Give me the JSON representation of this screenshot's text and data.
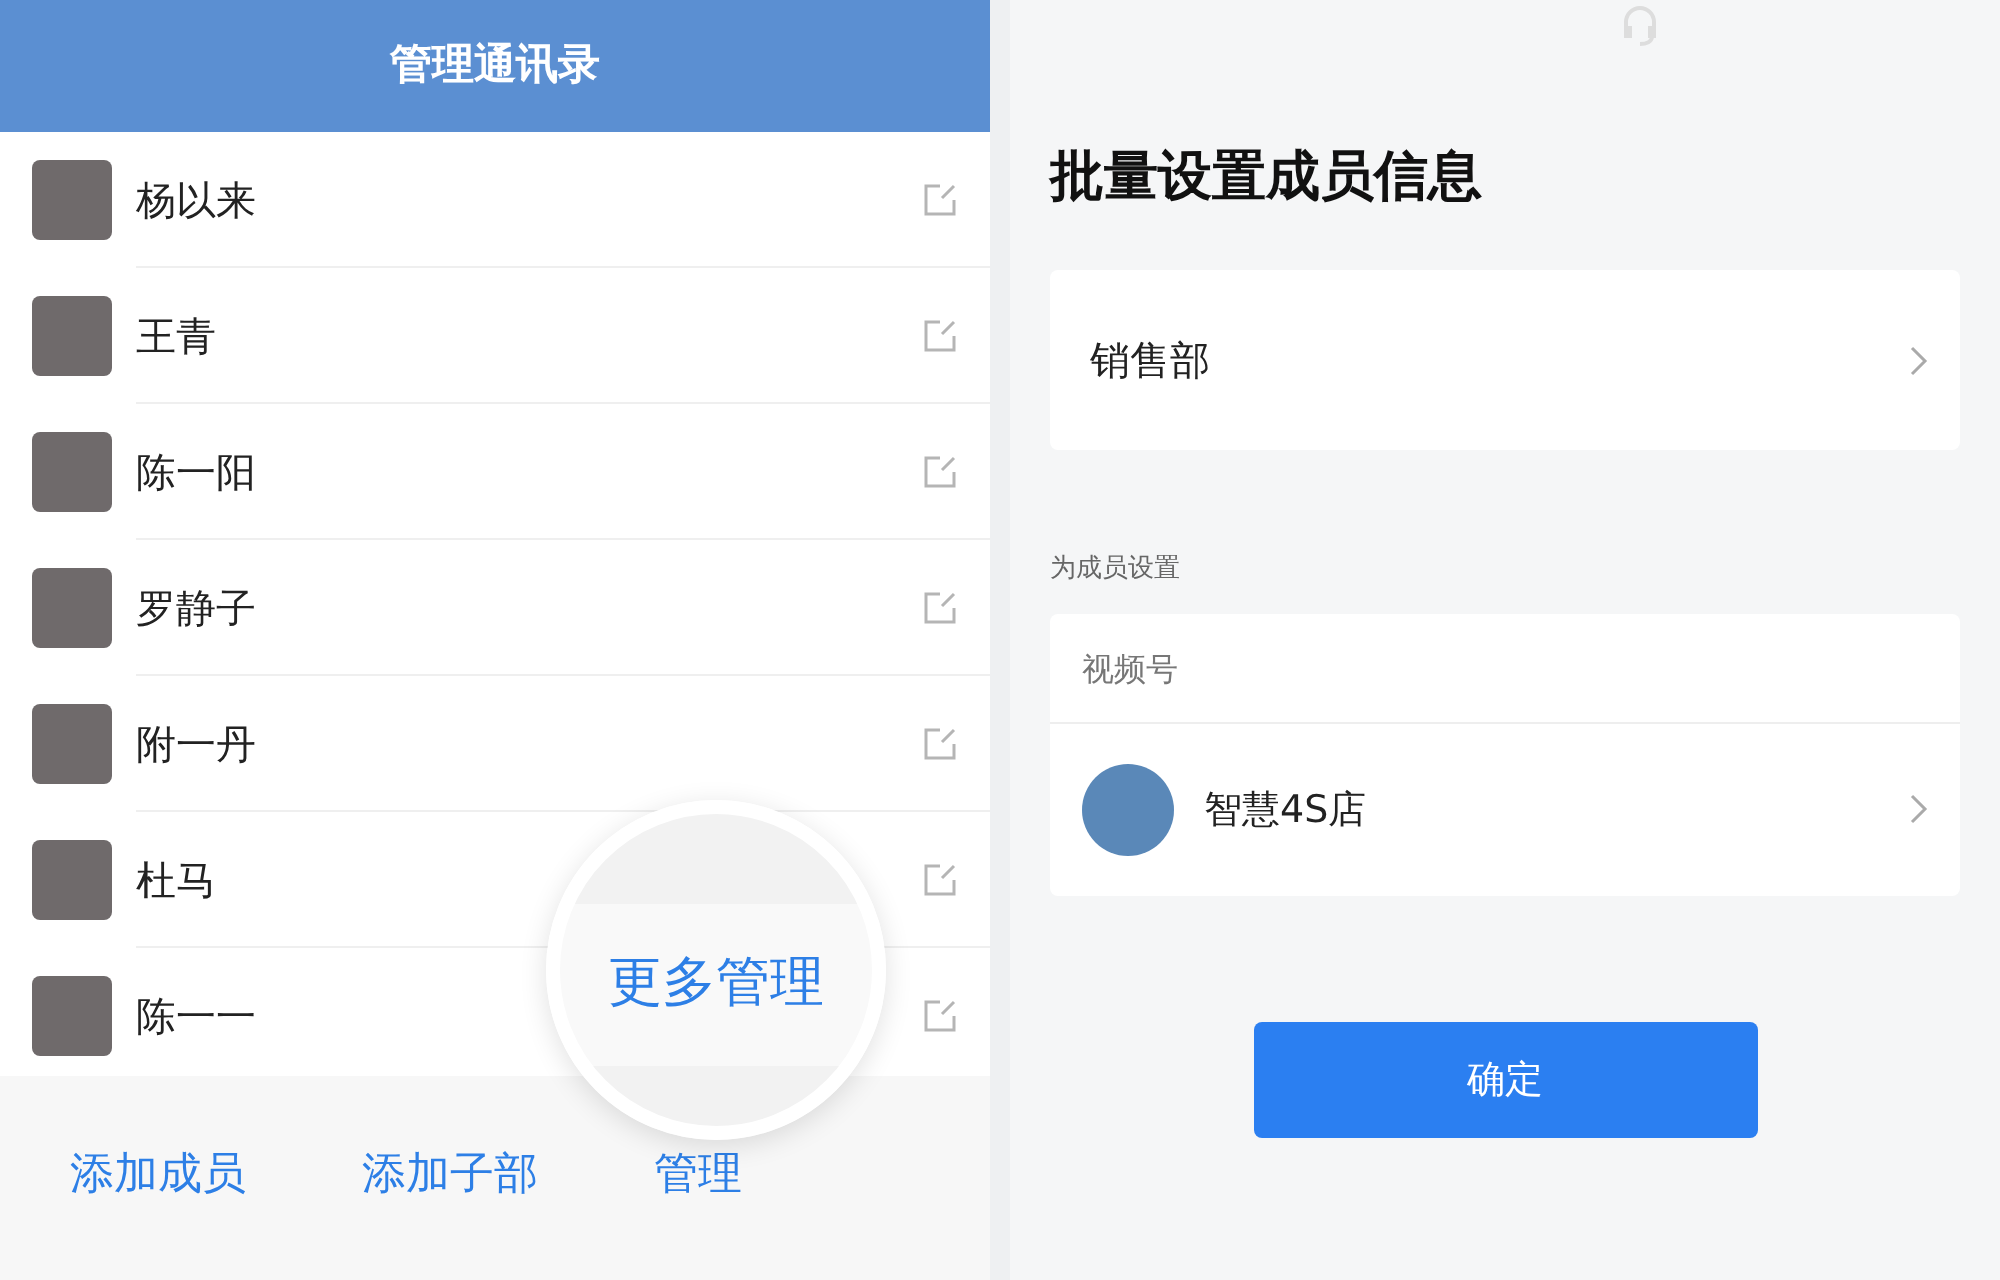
{
  "left_screen": {
    "title": "管理通讯录",
    "members": [
      {
        "name": "杨以来"
      },
      {
        "name": "王青"
      },
      {
        "name": "陈一阳"
      },
      {
        "name": "罗静子"
      },
      {
        "name": "附一丹"
      },
      {
        "name": "杜马"
      },
      {
        "name": "陈一一"
      }
    ],
    "bottom_actions": [
      "添加成员",
      "添加子部",
      "管理"
    ],
    "magnifier": {
      "label": "更多管理"
    }
  },
  "right_screen": {
    "title": "批量设置成员信息",
    "department": "销售部",
    "section_label": "为成员设置",
    "setting_card": {
      "title": "视频号",
      "account": "智慧4S店"
    },
    "confirm_button": "确定"
  }
}
